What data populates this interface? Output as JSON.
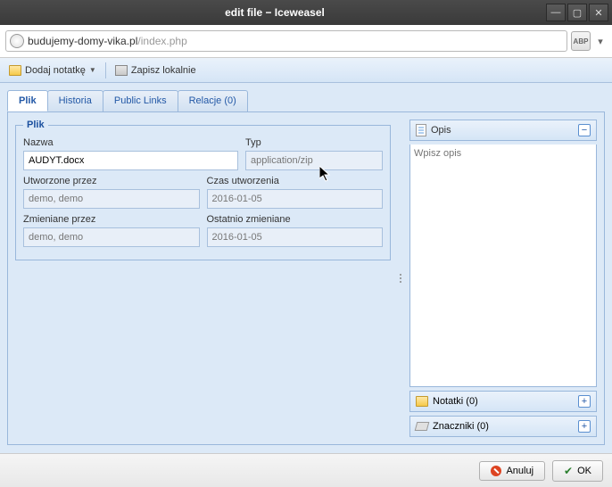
{
  "window": {
    "title": "edit file − Iceweasel"
  },
  "url": {
    "domain": "budujemy-domy-vika.pl",
    "path": "/index.php"
  },
  "toolbar": {
    "add_note": "Dodaj notatkę",
    "save_local": "Zapisz lokalnie"
  },
  "tabs": {
    "plik": "Plik",
    "historia": "Historia",
    "public": "Public Links",
    "relacje": "Relacje (0)"
  },
  "form": {
    "legend": "Plik",
    "name_label": "Nazwa",
    "name_value": "AUDYT.docx",
    "type_label": "Typ",
    "type_value": "application/zip",
    "created_by_label": "Utworzone przez",
    "created_by_value": "demo, demo",
    "created_at_label": "Czas utworzenia",
    "created_at_value": "2016-01-05",
    "modified_by_label": "Zmieniane przez",
    "modified_by_value": "demo, demo",
    "modified_at_label": "Ostatnio zmieniane",
    "modified_at_value": "2016-01-05"
  },
  "opis": {
    "title": "Opis",
    "placeholder": "Wpisz opis"
  },
  "notatki": {
    "title": "Notatki (0)"
  },
  "znaczniki": {
    "title": "Znaczniki (0)"
  },
  "buttons": {
    "cancel": "Anuluj",
    "ok": "OK"
  }
}
